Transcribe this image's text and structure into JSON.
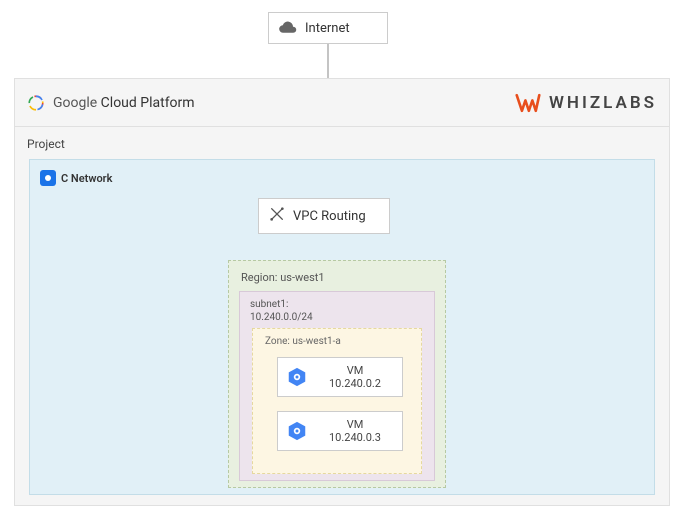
{
  "internet": {
    "label": "Internet",
    "icon": "cloud-icon"
  },
  "platform_header": {
    "gcp_text_prefix": "Google ",
    "gcp_text_suffix": "Cloud Platform",
    "whizlabs_label": "WHIZLABS"
  },
  "project": {
    "label": "Project"
  },
  "network": {
    "label": "C Network",
    "icon": "network-icon"
  },
  "vpc_routing": {
    "label": "VPC Routing",
    "icon": "routing-icon"
  },
  "region": {
    "label": "Region: us-west1"
  },
  "subnet": {
    "name": "subnet1:",
    "cidr": "10.240.0.0/24"
  },
  "zone": {
    "label": "Zone: us-west1-a"
  },
  "vms": [
    {
      "name": "VM",
      "ip": "10.240.0.2"
    },
    {
      "name": "VM",
      "ip": "10.240.0.3"
    }
  ]
}
